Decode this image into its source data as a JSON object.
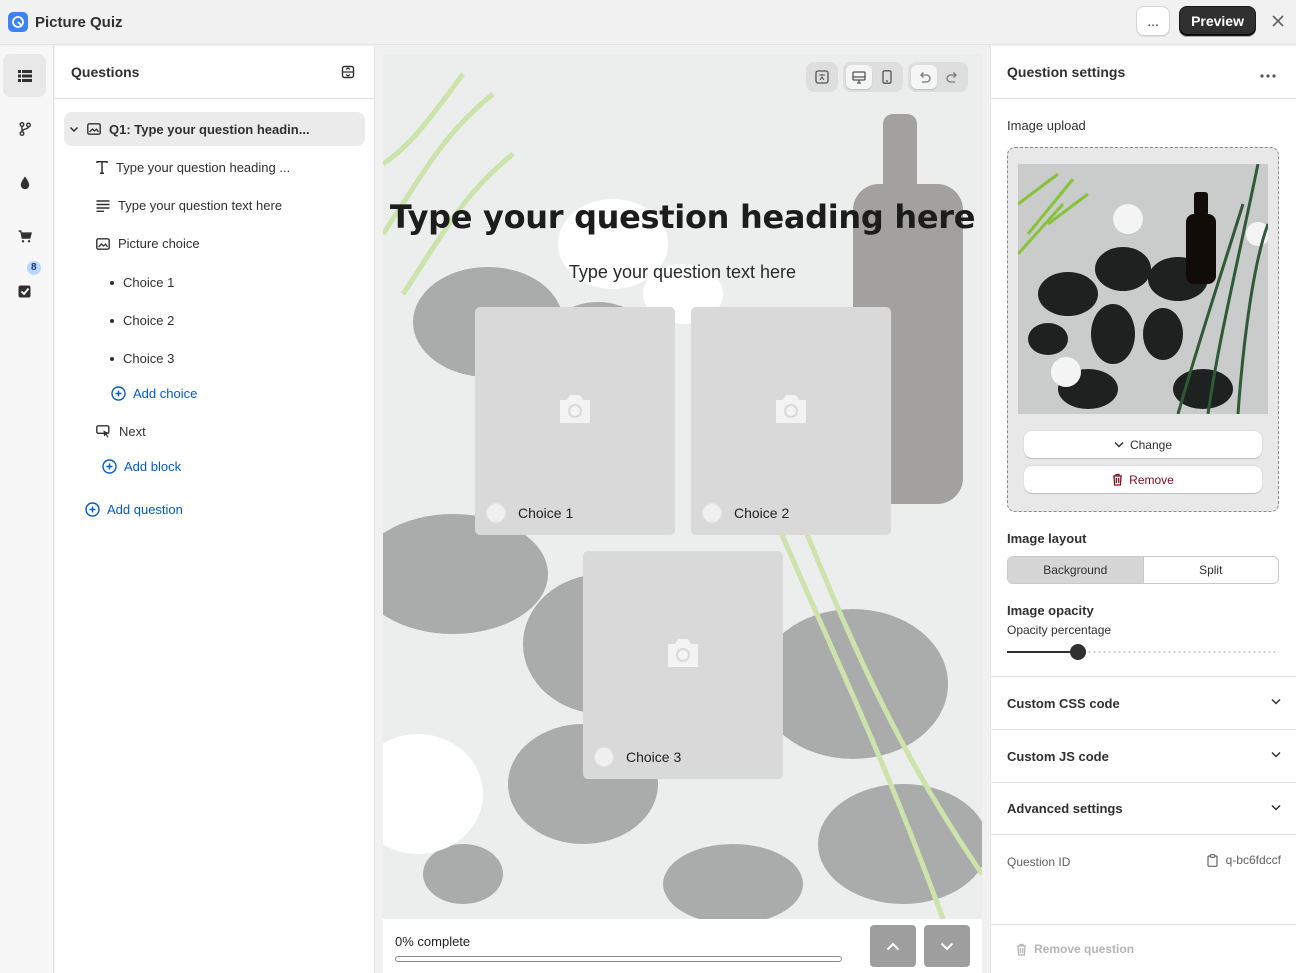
{
  "app": {
    "title": "Picture Quiz"
  },
  "header": {
    "more_label": "...",
    "preview_label": "Preview"
  },
  "rail": {
    "badge_count": "8"
  },
  "questions_panel": {
    "title": "Questions",
    "question_title": "Q1: Type your question headin...",
    "items": {
      "heading": "Type your question heading ...",
      "text": "Type your question text here",
      "picture_choice": "Picture choice",
      "choices": [
        "Choice 1",
        "Choice 2",
        "Choice 3"
      ],
      "add_choice": "Add choice",
      "next": "Next",
      "add_block": "Add block"
    },
    "add_question": "Add question"
  },
  "canvas": {
    "heading": "Type your question heading here",
    "text": "Type your question text here",
    "choices": [
      "Choice 1",
      "Choice 2",
      "Choice 3"
    ],
    "progress_label": "0% complete",
    "progress_fraction": 0
  },
  "settings": {
    "title": "Question settings",
    "image_upload_label": "Image upload",
    "change_label": "Change",
    "remove_label": "Remove",
    "image_layout_label": "Image layout",
    "layout_options": [
      "Background",
      "Split"
    ],
    "layout_selected": "Background",
    "opacity_label": "Image opacity",
    "opacity_sublabel": "Opacity percentage",
    "opacity_value": 0.26,
    "accordions": [
      "Custom CSS code",
      "Custom JS code",
      "Advanced settings"
    ],
    "question_id_label": "Question ID",
    "question_id": "q-bc6fdccf",
    "remove_question_label": "Remove question"
  },
  "colors": {
    "accent": "#005bd3",
    "dark_button": "#303030",
    "danger": "#8e0b21"
  }
}
